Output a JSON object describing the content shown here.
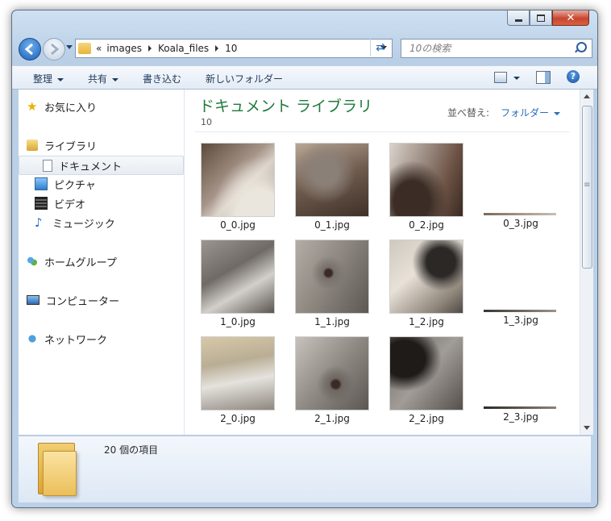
{
  "address": {
    "overflow": "«",
    "crumbs": [
      "images",
      "Koala_files",
      "10"
    ]
  },
  "search": {
    "placeholder": "10の検索"
  },
  "toolbar": {
    "organize": "整理",
    "share": "共有",
    "burn": "書き込む",
    "new_folder": "新しいフォルダー",
    "help": "?"
  },
  "sidebar": {
    "favorites": "お気に入り",
    "libraries": "ライブラリ",
    "documents": "ドキュメント",
    "pictures": "ピクチャ",
    "videos": "ビデオ",
    "music": "ミュージック",
    "homegroup": "ホームグループ",
    "computer": "コンピューター",
    "network": "ネットワーク"
  },
  "library": {
    "title": "ドキュメント ライブラリ",
    "subtitle": "10",
    "arrange_label": "並べ替え:",
    "arrange_value": "フォルダー"
  },
  "files": [
    {
      "name": "0_0.jpg"
    },
    {
      "name": "0_1.jpg"
    },
    {
      "name": "0_2.jpg"
    },
    {
      "name": "0_3.jpg"
    },
    {
      "name": "1_0.jpg"
    },
    {
      "name": "1_1.jpg"
    },
    {
      "name": "1_2.jpg"
    },
    {
      "name": "1_3.jpg"
    },
    {
      "name": "2_0.jpg"
    },
    {
      "name": "2_1.jpg"
    },
    {
      "name": "2_2.jpg"
    },
    {
      "name": "2_3.jpg"
    }
  ],
  "details": {
    "count": "20 個の項目"
  },
  "colors": {
    "accent_title": "#1f7a3c",
    "link": "#2a6bb5"
  }
}
